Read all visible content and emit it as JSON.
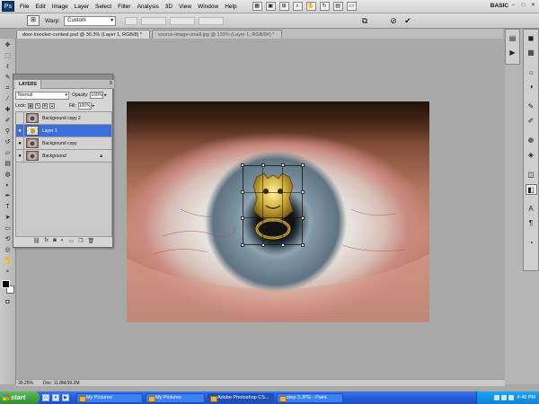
{
  "app": {
    "logo_text": "Ps",
    "workspace": "BASIC",
    "window_controls": [
      "–",
      "□",
      "✕"
    ]
  },
  "menu": [
    "File",
    "Edit",
    "Image",
    "Layer",
    "Select",
    "Filter",
    "Analysis",
    "3D",
    "View",
    "Window",
    "Help"
  ],
  "options_bar": {
    "warp_label": "Warp:",
    "warp_value": "Custom"
  },
  "tabs": [
    "door-knocker-contest.psd @ 30.3% (Layer 1, RGB/8) *",
    "source-image-small.jpg @ 133% (Layer 1, RGB/8#) *"
  ],
  "layers_panel": {
    "title": "LAYERS",
    "blend_mode": "Normal",
    "opacity_label": "Opacity:",
    "opacity_value": "100%",
    "lock_label": "Lock:",
    "fill_label": "Fill:",
    "fill_value": "100%",
    "layers": [
      {
        "name": "Background copy 2",
        "visible": false,
        "selected": false
      },
      {
        "name": "Layer 1",
        "visible": true,
        "selected": true
      },
      {
        "name": "Background copy",
        "visible": true,
        "selected": false
      },
      {
        "name": "Background",
        "visible": true,
        "selected": false,
        "locked": true
      }
    ]
  },
  "status": {
    "zoom": "30.25%",
    "doc": "Doc: 11.8M/39.2M"
  },
  "taskbar": {
    "start": "start",
    "buttons": [
      "My Pictures",
      "My Pictures",
      "Adobe Photoshop CS...",
      "step 3.JPG - Paint"
    ],
    "active_index": 2,
    "clock": "4:48 PM"
  },
  "colors": {
    "taskbar_blue": "#245edb",
    "start_green": "#3c9a3c",
    "selection_blue": "#3d6fd8",
    "knocker_gold": "#c7a233"
  }
}
